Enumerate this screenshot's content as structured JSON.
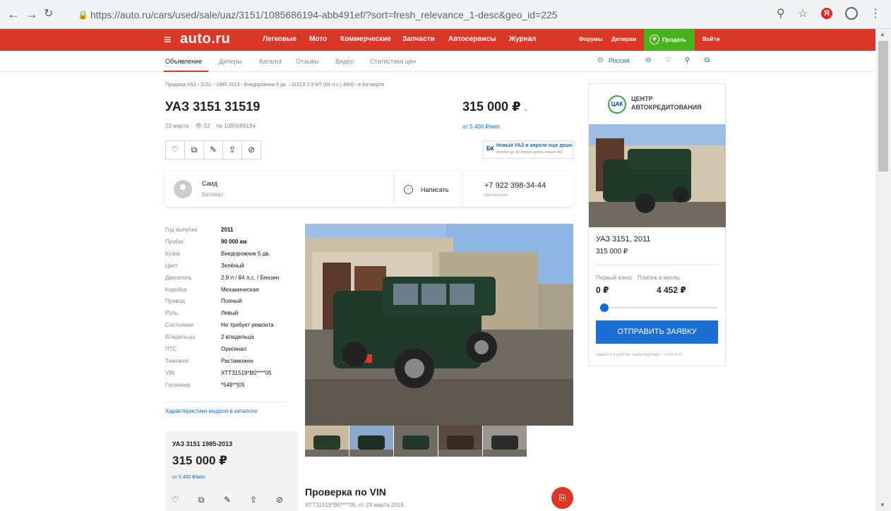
{
  "browser": {
    "url": "https://auto.ru/cars/used/sale/uaz/3151/1085686194-abb491ef/?sort=fresh_relevance_1-desc&geo_id=225",
    "back_icon": "arrow-left-icon",
    "forward_icon": "arrow-right-icon",
    "reload_icon": "reload-icon",
    "yandex_badge": "Я"
  },
  "header": {
    "logo": "auto.ru",
    "nav": [
      "Легковые",
      "Мото",
      "Коммерческие",
      "Запчасти",
      "Автосервисы",
      "Журнал"
    ],
    "forums": "Форумы",
    "dealers": "Дилерам",
    "sell": "Продать",
    "login": "Войти",
    "brand_color": "#db3727",
    "sell_color": "#46b31a"
  },
  "subnav": {
    "tabs": [
      "Объявление",
      "Дилеры",
      "Каталог",
      "Отзывы",
      "Видео",
      "Статистика цен"
    ],
    "region": "Россия"
  },
  "listing": {
    "breadcrumb": "Продажа УАЗ  ›  3151  ›  1985-2013  ›  Внедорожник 5 дв.  ›  31519 2.9 MT (84 л.с.) 4WD  ›  в Батаюрте",
    "title": "УАЗ 3151 31519",
    "price": "315 000 ₽",
    "monthly": "от 5 400 ₽/мес",
    "date": "23 марта",
    "views": "53",
    "number": "№ 1085686194"
  },
  "promo": {
    "logo": "БК",
    "title": "Новый УАЗ в апреле еще дешевле",
    "subtitle": "Успейте до 30 апреля купить новый УАЗ"
  },
  "seller": {
    "name": "Саид",
    "city": "Батаюрт",
    "write": "Написать",
    "phone": "+7 922 398-34-44",
    "hours": "Круглосуточно"
  },
  "specs": [
    {
      "k": "Год выпуска",
      "v": "2011",
      "bold": true
    },
    {
      "k": "Пробег",
      "v": "90 000 км",
      "bold": true
    },
    {
      "k": "Кузов",
      "v": "Внедорожник 5 дв."
    },
    {
      "k": "Цвет",
      "v": "Зелёный"
    },
    {
      "k": "Двигатель",
      "v": "2.9 л / 84 л.с. / Бензин"
    },
    {
      "k": "Коробка",
      "v": "Механическая"
    },
    {
      "k": "Привод",
      "v": "Полный"
    },
    {
      "k": "Руль",
      "v": "Левый"
    },
    {
      "k": "Состояние",
      "v": "Не требует ремонта"
    },
    {
      "k": "Владельцы",
      "v": "2 владельца"
    },
    {
      "k": "ПТС",
      "v": "Оригинал"
    },
    {
      "k": "Таможня",
      "v": "Растаможен"
    },
    {
      "k": "VIN",
      "v": "XTT31519*B0****05"
    },
    {
      "k": "Госномер",
      "v": "*549**|05"
    }
  ],
  "catalog_link": "Характеристики модели в каталоге",
  "mini": {
    "title": "УАЗ 3151 1985-2013",
    "price": "315 000 ₽",
    "monthly": "от 5 400 ₽/мес"
  },
  "vin": {
    "title": "Проверка по VIN",
    "subtitle": "XTT31519*B0****05, от 24 марта 2019"
  },
  "credit": {
    "logo": "ЦАК",
    "line1": "ЦЕНТР",
    "line2": "АВТОКРЕДИТОВАНИЯ",
    "model": "УАЗ 3151, 2011",
    "price": "315 000 ₽",
    "first_label": "Первый взнос",
    "first_value": "0 ₽",
    "month_label": "Платеж в месяц",
    "month_value": "4 452 ₽",
    "slider_fraction": 0.0,
    "button": "ОТПРАВИТЬ ЗАЯВКУ",
    "note": "ывается в рублях. Банк-партнёр – ПАО «Пл"
  }
}
